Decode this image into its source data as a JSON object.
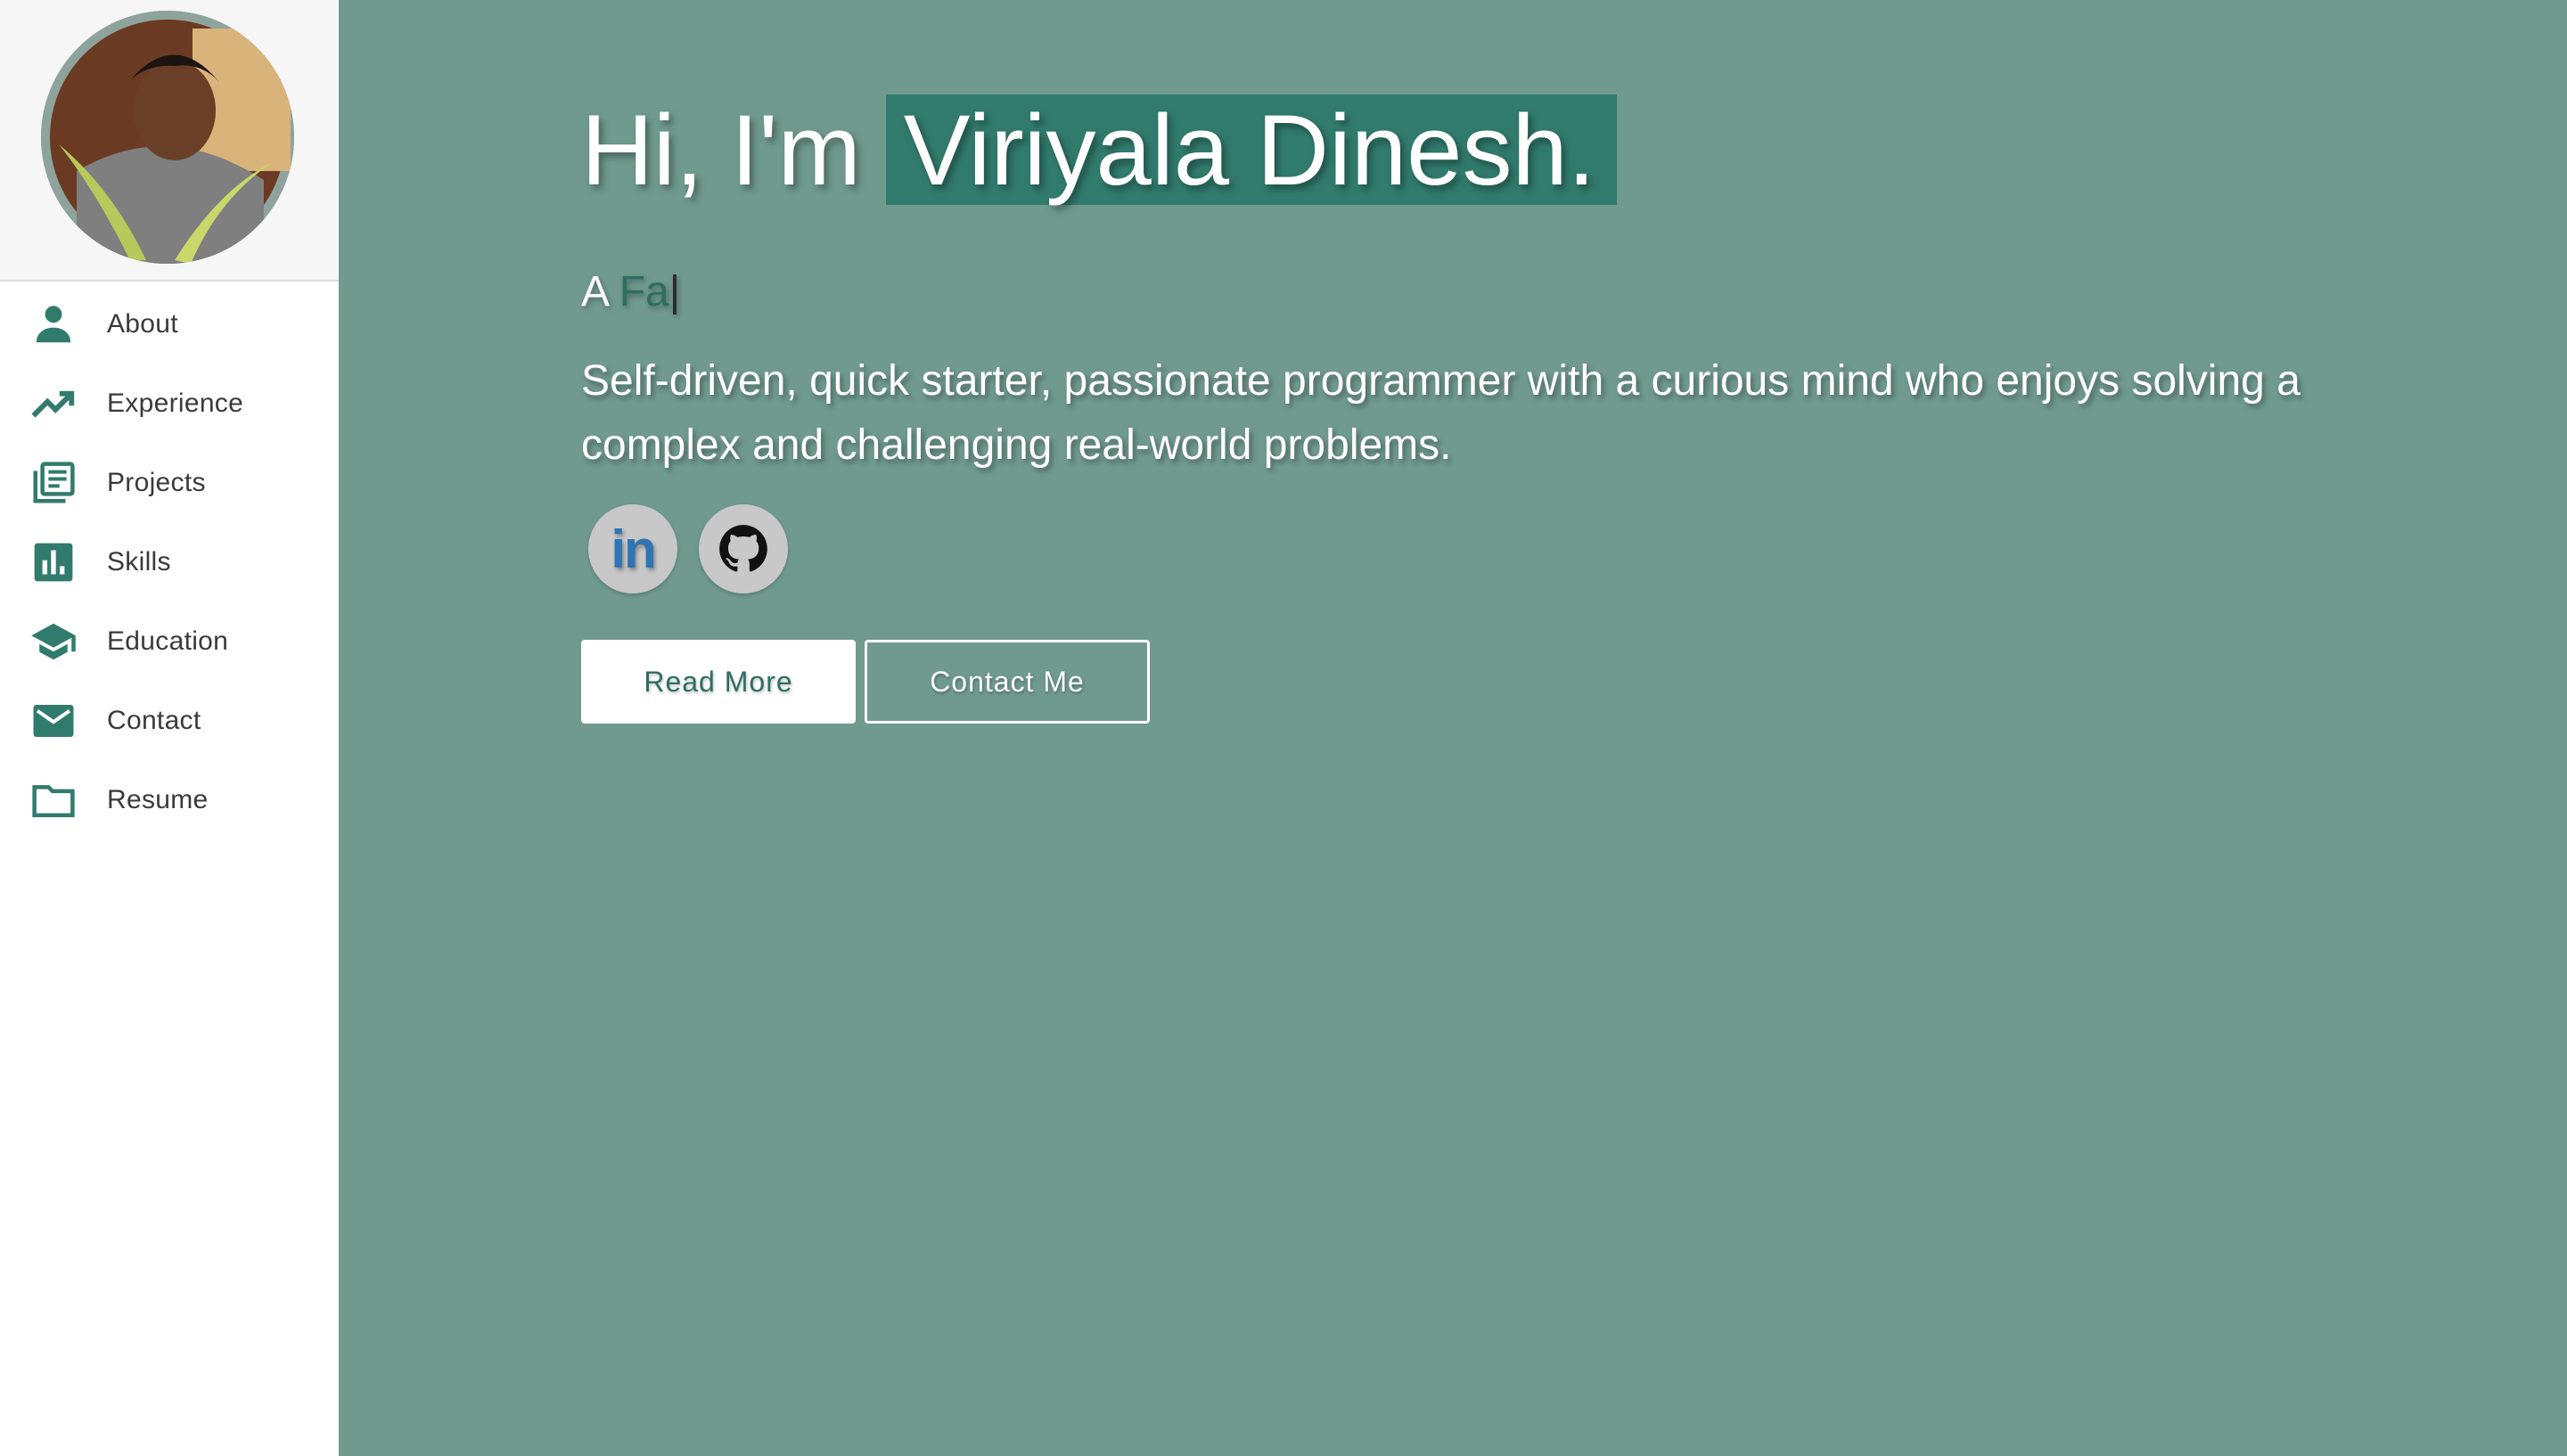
{
  "sidebar": {
    "items": [
      {
        "label": "About",
        "icon": "person-icon"
      },
      {
        "label": "Experience",
        "icon": "trending-up-icon"
      },
      {
        "label": "Projects",
        "icon": "library-books-icon"
      },
      {
        "label": "Skills",
        "icon": "bar-chart-icon"
      },
      {
        "label": "Education",
        "icon": "graduation-cap-icon"
      },
      {
        "label": "Contact",
        "icon": "mail-icon"
      },
      {
        "label": "Resume",
        "icon": "folder-icon"
      }
    ]
  },
  "hero": {
    "greeting": "Hi, I'm",
    "name": "Viriyala Dinesh.",
    "typed_prefix": "A",
    "typed_text": "Fa",
    "typed_cursor": "|",
    "description": "Self-driven, quick starter, passionate programmer with a curious mind who enjoys solving a complex and challenging real-world problems."
  },
  "socials": [
    {
      "name": "linkedin",
      "glyph": "in",
      "icon": "linkedin-icon"
    },
    {
      "name": "github",
      "icon": "github-icon"
    }
  ],
  "buttons": {
    "read_more": "Read More",
    "contact_me": "Contact Me"
  },
  "colors": {
    "accent": "#317b6d",
    "background": "#709a8e",
    "sidebar_bg": "#ffffff"
  }
}
